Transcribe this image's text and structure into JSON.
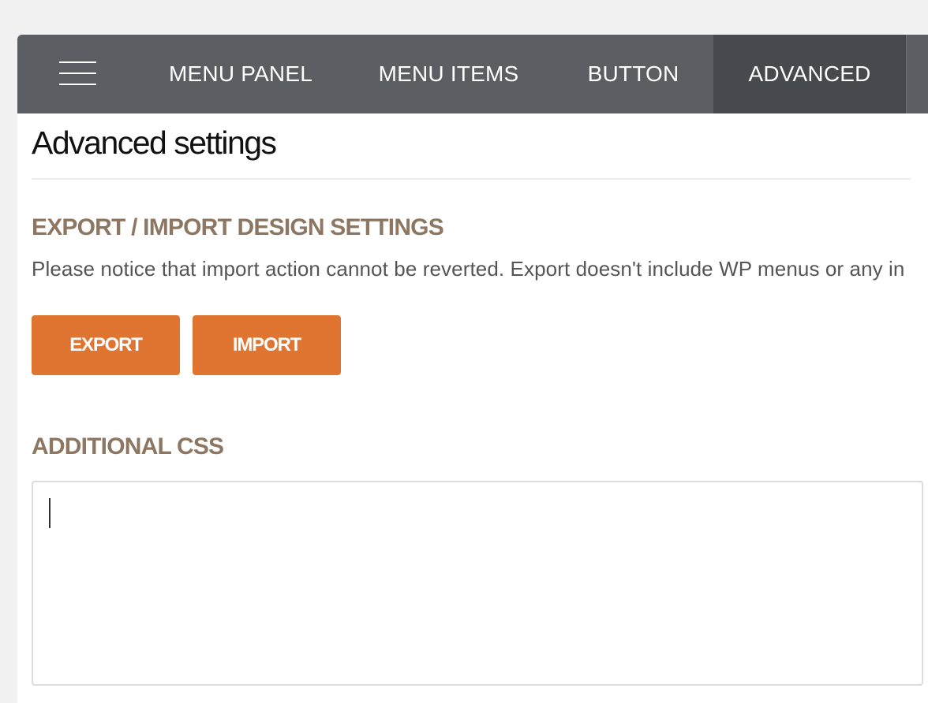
{
  "topbar": {
    "menu_icon": "hamburger-icon",
    "tabs": [
      {
        "label": "MENU PANEL"
      },
      {
        "label": "MENU ITEMS"
      },
      {
        "label": "BUTTON"
      },
      {
        "label": "ADVANCED",
        "active": true
      }
    ]
  },
  "main": {
    "title": "Advanced settings",
    "export_import": {
      "heading": "EXPORT / IMPORT DESIGN SETTINGS",
      "notice": "Please notice that import action cannot be reverted. Export doesn't include WP menus or any in",
      "export_label": "EXPORT",
      "import_label": "IMPORT"
    },
    "additional_css": {
      "heading": "ADDITIONAL CSS",
      "value": ""
    }
  },
  "colors": {
    "topbar_bg": "#5b5e63",
    "active_tab_bg": "#46494d",
    "section_heading": "#8d7762",
    "button_bg": "#df7530"
  }
}
